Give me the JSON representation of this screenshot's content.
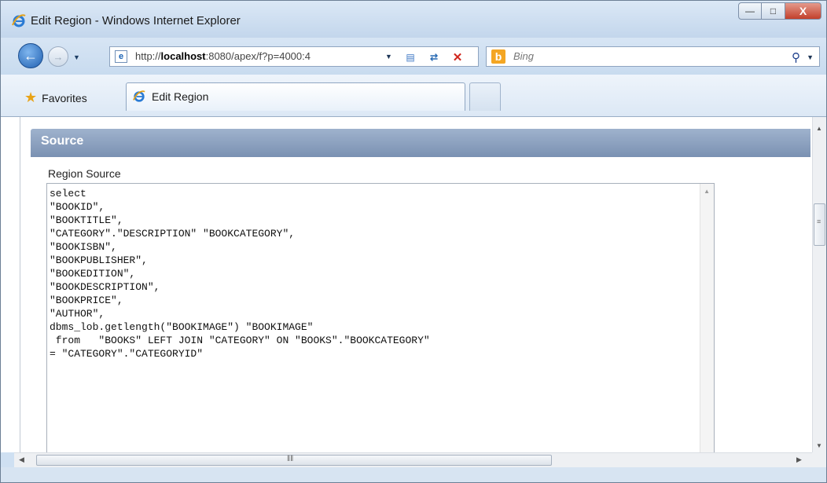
{
  "window": {
    "title": "Edit Region - Windows Internet Explorer",
    "controls": {
      "minimize": "—",
      "maximize": "□",
      "close": "X"
    }
  },
  "navbar": {
    "url_prefix": "http://",
    "url_host": "localhost",
    "url_rest": ":8080/apex/f?p=4000:4",
    "search_placeholder": "Bing"
  },
  "tabs": {
    "favorites_label": "Favorites",
    "active_tab_label": "Edit Region"
  },
  "content": {
    "section_title": "Source",
    "field_label": "Region Source",
    "source_lines": [
      "select",
      "\"BOOKID\",",
      "\"BOOKTITLE\",",
      "\"CATEGORY\".\"DESCRIPTION\" \"BOOKCATEGORY\",",
      "\"BOOKISBN\",",
      "\"BOOKPUBLISHER\",",
      "\"BOOKEDITION\",",
      "\"BOOKDESCRIPTION\",",
      "\"BOOKPRICE\",",
      "\"AUTHOR\",",
      "dbms_lob.getlength(\"BOOKIMAGE\") \"BOOKIMAGE\"",
      " from   \"BOOKS\" LEFT JOIN \"CATEGORY\" ON \"BOOKS\".\"BOOKCATEGORY\"",
      "= \"CATEGORY\".\"CATEGORYID\""
    ]
  },
  "icons": {
    "ie": "ie-logo-icon",
    "back": "back-arrow-icon",
    "forward": "forward-arrow-icon",
    "compat": "compatibility-view-icon",
    "refresh": "refresh-icon",
    "stop": "stop-icon",
    "bing": "bing-logo-icon",
    "search": "search-icon",
    "favorites": "favorites-star-icon"
  },
  "colors": {
    "header_bar": "#7a91b2",
    "frame": "#cfe0f2",
    "stop_red": "#d0251c",
    "bing_orange": "#f4a623"
  }
}
